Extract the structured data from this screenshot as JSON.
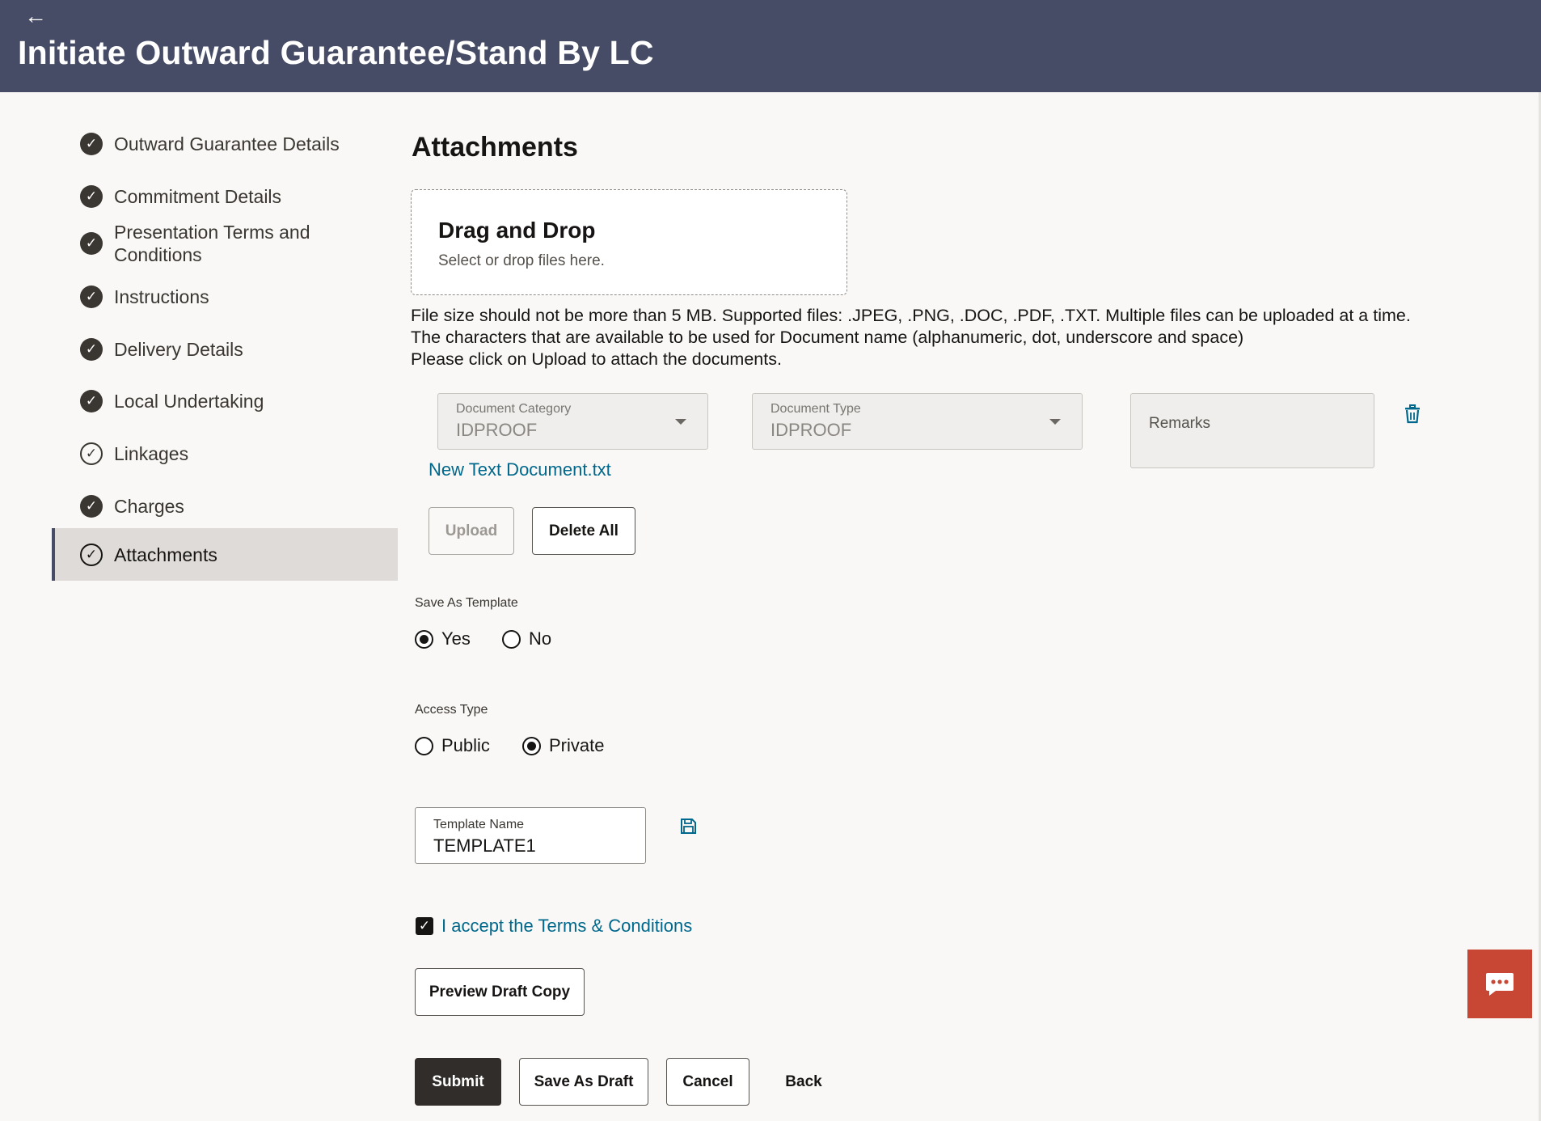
{
  "header": {
    "back_icon": "arrow-left-icon",
    "title": "Initiate Outward Guarantee/Stand By LC"
  },
  "sidebar": {
    "items": [
      {
        "label": "Outward Guarantee Details",
        "status": "completed"
      },
      {
        "label": "Commitment Details",
        "status": "completed"
      },
      {
        "label": "Presentation Terms and Conditions",
        "status": "completed"
      },
      {
        "label": "Instructions",
        "status": "completed"
      },
      {
        "label": "Delivery Details",
        "status": "completed"
      },
      {
        "label": "Local Undertaking",
        "status": "completed"
      },
      {
        "label": "Linkages",
        "status": "outline"
      },
      {
        "label": "Charges",
        "status": "completed"
      },
      {
        "label": "Attachments",
        "status": "active"
      }
    ]
  },
  "attachments": {
    "title": "Attachments",
    "dropzone": {
      "title": "Drag and Drop",
      "subtitle": "Select or drop files here."
    },
    "info_lines": [
      "File size should not be more than 5 MB. Supported files: .JPEG, .PNG, .DOC, .PDF, .TXT. Multiple files can be uploaded at a time.",
      "The characters that are available to be used for Document name (alphanumeric, dot, underscore and space)",
      "Please click on Upload to attach the documents."
    ],
    "document_category": {
      "label": "Document Category",
      "value": "IDPROOF"
    },
    "document_type": {
      "label": "Document Type",
      "value": "IDPROOF"
    },
    "remarks": {
      "label": "Remarks",
      "value": ""
    },
    "file_name": "New Text Document.txt",
    "upload_label": "Upload",
    "delete_all_label": "Delete All"
  },
  "save_as_template": {
    "label": "Save As Template",
    "options": [
      "Yes",
      "No"
    ],
    "selected": "Yes"
  },
  "access_type": {
    "label": "Access Type",
    "options": [
      "Public",
      "Private"
    ],
    "selected": "Private"
  },
  "template_name": {
    "label": "Template Name",
    "value": "TEMPLATE1"
  },
  "terms": {
    "label": "I accept the Terms & Conditions",
    "checked": true
  },
  "actions": {
    "preview": "Preview Draft Copy",
    "submit": "Submit",
    "save_draft": "Save As Draft",
    "cancel": "Cancel",
    "back": "Back"
  },
  "colors": {
    "header_bg": "#474c66",
    "link": "#00688c",
    "primary_button": "#312d2a",
    "chat_button": "#c74634"
  }
}
